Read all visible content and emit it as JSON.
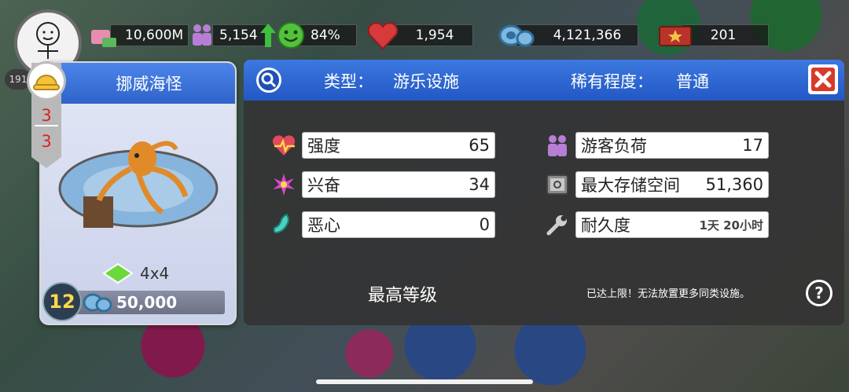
{
  "hud": {
    "player_level": "191",
    "money": "10,600M",
    "guests": "5,154",
    "happiness": "84%",
    "hearts": "1,954",
    "coins": "4,121,366",
    "tickets": "201"
  },
  "card": {
    "ride_name": "挪威海怪",
    "tier_current": "3",
    "tier_max": "3",
    "size": "4x4",
    "level": "12",
    "cost": "50,000"
  },
  "panel": {
    "type_label": "类型：",
    "type_value": "游乐设施",
    "rarity_label": "稀有程度：",
    "rarity_value": "普通",
    "stats": {
      "intensity_label": "强度",
      "intensity_value": "65",
      "excitement_label": "兴奋",
      "excitement_value": "34",
      "nausea_label": "恶心",
      "nausea_value": "0",
      "capacity_label": "游客负荷",
      "capacity_value": "17",
      "storage_label": "最大存储空间",
      "storage_value": "51,360",
      "durability_label": "耐久度",
      "durability_value": "1天 20小时"
    },
    "max_level_text": "最高等级",
    "limit_note": "已达上限！无法放置更多同类设施。",
    "help_label": "?"
  },
  "colors": {
    "header_blue": "#2f63c9",
    "tier_red": "#d22222",
    "level_yellow": "#ffd94a"
  }
}
